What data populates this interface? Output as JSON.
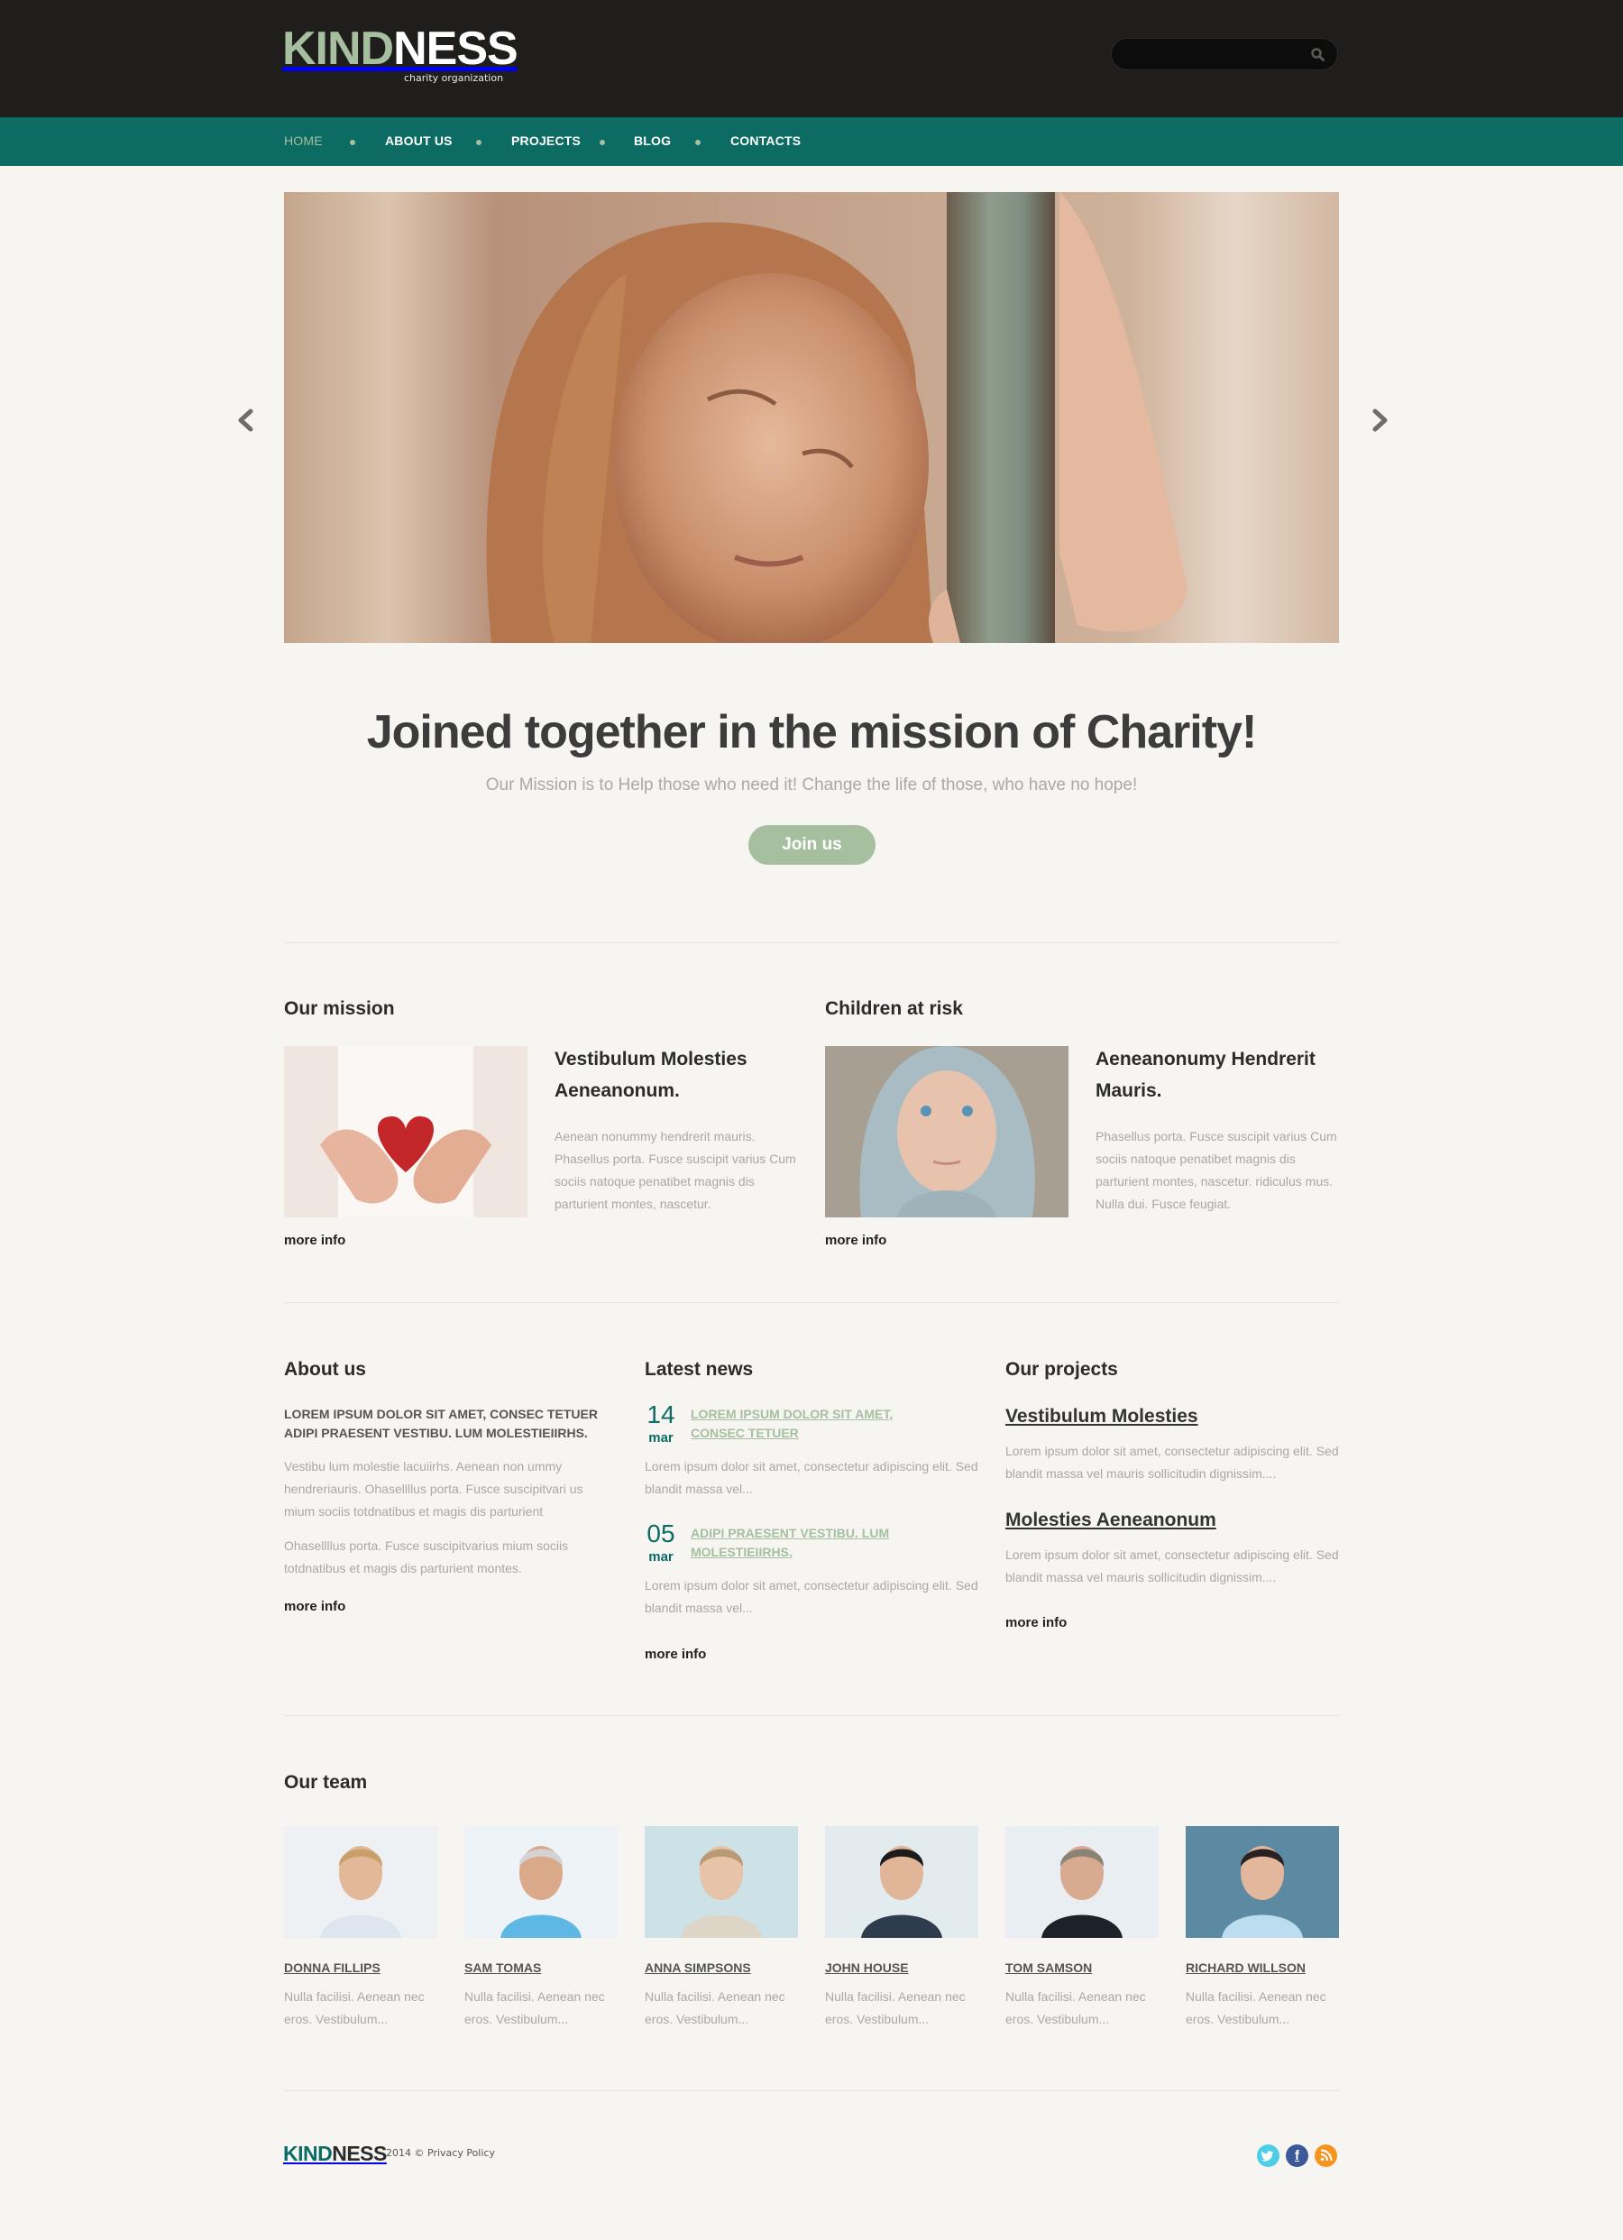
{
  "header": {
    "logo_part1": "KIND",
    "logo_part2": "NESS",
    "tagline": "charity organization",
    "search": {
      "placeholder": "",
      "value": "",
      "icon": "search-icon"
    }
  },
  "nav": {
    "items": [
      {
        "label": "HOME",
        "active": true
      },
      {
        "label": "ABOUT US",
        "active": false
      },
      {
        "label": "PROJECTS",
        "active": false
      },
      {
        "label": "BLOG",
        "active": false
      },
      {
        "label": "CONTACTS",
        "active": false
      }
    ]
  },
  "slider": {
    "image": "sad-girl-leaning-on-pole-photo",
    "prev_icon": "chevron-left-icon",
    "next_icon": "chevron-right-icon"
  },
  "hero": {
    "headline": "Joined together in the mission of Charity!",
    "subtitle": "Our Mission is to Help those who need it! Change the life of those, who have no hope!",
    "button_label": "Join us"
  },
  "features": [
    {
      "section_title": "Our mission",
      "image": "hands-holding-red-heart-photo",
      "heading": "Vestibulum Molesties Aeneanonum.",
      "text": "Aenean nonummy hendrerit mauris. Phasellus porta.  Fusce suscipit varius Cum sociis natoque penatibet magnis dis parturient montes, nascetur.",
      "link": "more info"
    },
    {
      "section_title": "Children at risk",
      "image": "girl-in-grey-hood-photo",
      "heading": "Aeneanonumy Hendrerit Mauris.",
      "text": "Phasellus porta.  Fusce suscipit varius Cum sociis natoque penatibet magnis dis parturient montes, nascetur. ridiculus mus. Nulla dui. Fusce feugiat.",
      "link": "more info"
    }
  ],
  "about": {
    "title": "About us",
    "lead": "LOREM IPSUM DOLOR SIT AMET, CONSEC TETUER ADIPI PRAESENT VESTIBU.  LUM MOLESTIEIIRHS.",
    "para1": "Vestibu lum molestie lacuiirhs. Aenean non ummy hendreriauris. Ohasellllus porta. Fusce suscipitvari us mium sociis totdnatibus et magis dis parturient",
    "para2": "Ohasellllus porta. Fusce suscipitvarius mium sociis totdnatibus et magis dis parturient montes.",
    "link": "more info"
  },
  "news": {
    "title": "Latest news",
    "items": [
      {
        "day": "14",
        "month": "mar",
        "title": "LOREM IPSUM DOLOR SIT AMET, CONSEC TETUER",
        "text": "Lorem ipsum dolor sit amet, consectetur adipiscing elit. Sed blandit massa vel..."
      },
      {
        "day": "05",
        "month": "mar",
        "title": "ADIPI PRAESENT VESTIBU. LUM MOLESTIEIIRHS.",
        "text": "Lorem ipsum dolor sit amet, consectetur adipiscing elit. Sed blandit massa vel..."
      }
    ],
    "link": "more info"
  },
  "projects": {
    "title": "Our projects",
    "items": [
      {
        "title": "Vestibulum Molesties",
        "text": "Lorem ipsum dolor sit amet, consectetur adipiscing elit. Sed blandit massa vel mauris sollicitudin dignissim...."
      },
      {
        "title": "Molesties Aeneanonum",
        "text": "Lorem ipsum dolor sit amet, consectetur adipiscing elit. Sed blandit massa vel mauris sollicitudin dignissim...."
      }
    ],
    "link": "more info"
  },
  "team": {
    "title": "Our team",
    "members": [
      {
        "name": "DONNA FILLIPS",
        "desc": "Nulla facilisi. Aenean nec eros. Vestibulum...",
        "photo": "smiling-blonde-woman-photo"
      },
      {
        "name": "SAM TOMAS",
        "desc": "Nulla facilisi. Aenean nec eros. Vestibulum...",
        "photo": "smiling-grey-haired-man-photo"
      },
      {
        "name": "ANNA SIMPSONS",
        "desc": "Nulla facilisi. Aenean nec eros. Vestibulum...",
        "photo": "woman-in-beige-jacket-photo"
      },
      {
        "name": "JOHN HOUSE",
        "desc": "Nulla facilisi. Aenean nec eros. Vestibulum...",
        "photo": "man-with-glasses-photo"
      },
      {
        "name": "TOM SAMSON",
        "desc": "Nulla facilisi. Aenean nec eros. Vestibulum...",
        "photo": "man-in-dark-blazer-photo"
      },
      {
        "name": "RICHARD WILLSON",
        "desc": "Nulla facilisi. Aenean nec eros. Vestibulum...",
        "photo": "man-in-blue-shirt-photo"
      }
    ]
  },
  "footer": {
    "logo_part1": "KIND",
    "logo_part2": "NESS",
    "copyright": "2014 ©",
    "privacy_link": "Privacy Policy",
    "social": [
      {
        "name": "twitter",
        "icon": "twitter-icon",
        "color": "#4ecde6"
      },
      {
        "name": "facebook",
        "icon": "facebook-icon",
        "color": "#3b5998"
      },
      {
        "name": "rss",
        "icon": "rss-icon",
        "color": "#f7941d"
      }
    ]
  },
  "colors": {
    "brand_green": "#a5bf9f",
    "teal": "#0c6b63",
    "header_dark": "#1f1e1d",
    "page_bg": "#f6f5f2"
  }
}
